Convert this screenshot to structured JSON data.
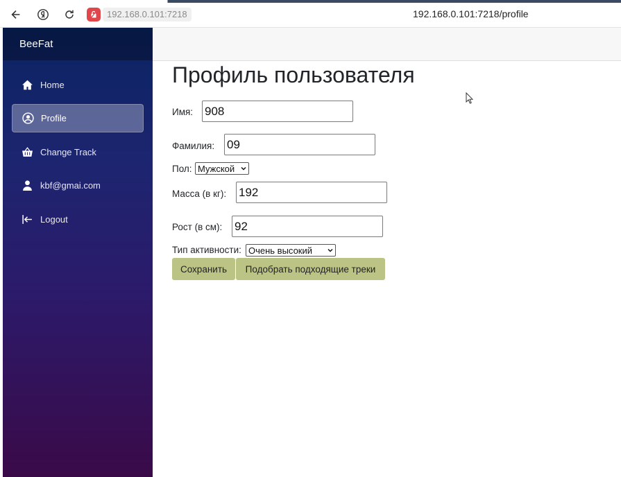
{
  "browser": {
    "address_short": "192.168.0.101:7218",
    "address_full": "192.168.0.101:7218/profile"
  },
  "sidebar": {
    "brand": "BeeFat",
    "items": [
      {
        "label": "Home",
        "icon": "home-icon"
      },
      {
        "label": "Profile",
        "icon": "user-circle-icon",
        "active": true
      },
      {
        "label": "Change Track",
        "icon": "basket-icon"
      },
      {
        "label": "kbf@gmai.com",
        "icon": "person-icon"
      },
      {
        "label": "Logout",
        "icon": "logout-icon"
      }
    ]
  },
  "profile": {
    "title": "Профиль пользователя",
    "name_label": "Имя:",
    "name_value": "908",
    "surname_label": "Фамилия:",
    "surname_value": "09",
    "gender_label": "Пол:",
    "gender_value": "Мужской",
    "mass_label": "Масса (в кг):",
    "mass_value": "192",
    "height_label": "Рост (в см):",
    "height_value": "92",
    "activity_label": "Тип активности:",
    "activity_value": "Очень высокий",
    "save_label": "Сохранить",
    "match_label": "Подобрать подходящие треки"
  },
  "colors": {
    "button_bg": "#bcc485",
    "sidebar_top": "#0a2362",
    "sidebar_bottom": "#3a0a48"
  }
}
